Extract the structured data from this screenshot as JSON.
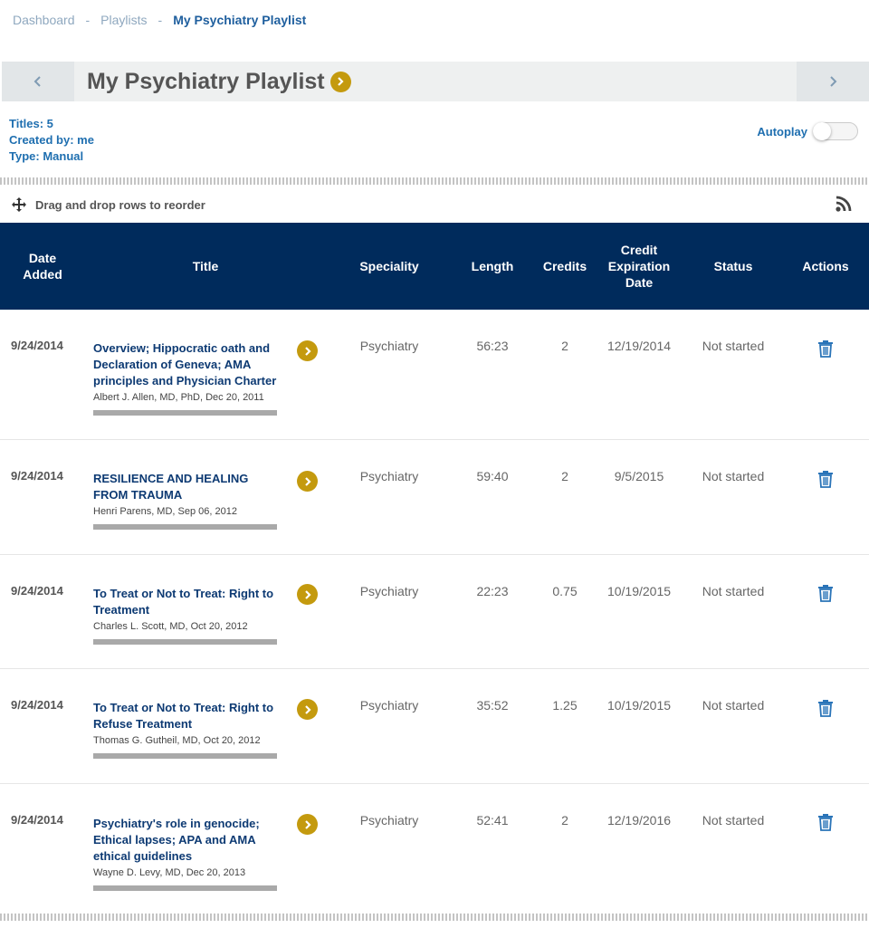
{
  "breadcrumb": {
    "items": [
      "Dashboard",
      "Playlists"
    ],
    "separator": "-",
    "current": "My Psychiatry Playlist"
  },
  "header": {
    "title": "My Psychiatry Playlist",
    "prev_icon": "chevron-left-icon",
    "next_icon": "chevron-right-icon"
  },
  "meta": {
    "titles": "Titles: 5",
    "created_by": "Created by: me",
    "type": "Type: Manual"
  },
  "autoplay": {
    "label": "Autoplay",
    "on": false
  },
  "reorder_hint": "Drag and drop rows to reorder",
  "columns": {
    "date_added": "Date Added",
    "title": "Title",
    "speciality": "Speciality",
    "length": "Length",
    "credits": "Credits",
    "credit_expiration": "Credit Expiration Date",
    "status": "Status",
    "actions": "Actions"
  },
  "rows": [
    {
      "date": "9/24/2014",
      "title": "Overview; Hippocratic oath and Declaration of Geneva; AMA principles and Physician Charter",
      "author": "Albert J. Allen, MD, PhD, Dec 20, 2011",
      "speciality": "Psychiatry",
      "length": "56:23",
      "credits": "2",
      "expiration": "12/19/2014",
      "status": "Not started"
    },
    {
      "date": "9/24/2014",
      "title": "RESILIENCE AND HEALING FROM TRAUMA",
      "author": "Henri Parens, MD, Sep 06, 2012",
      "speciality": "Psychiatry",
      "length": "59:40",
      "credits": "2",
      "expiration": "9/5/2015",
      "status": "Not started"
    },
    {
      "date": "9/24/2014",
      "title": "To Treat or Not to Treat: Right to Treatment",
      "author": "Charles L. Scott, MD, Oct 20, 2012",
      "speciality": "Psychiatry",
      "length": "22:23",
      "credits": "0.75",
      "expiration": "10/19/2015",
      "status": "Not started"
    },
    {
      "date": "9/24/2014",
      "title": "To Treat or Not to Treat: Right to Refuse Treatment",
      "author": "Thomas G. Gutheil, MD, Oct 20, 2012",
      "speciality": "Psychiatry",
      "length": "35:52",
      "credits": "1.25",
      "expiration": "10/19/2015",
      "status": "Not started"
    },
    {
      "date": "9/24/2014",
      "title": "Psychiatry's role in genocide; Ethical lapses; APA and AMA ethical guidelines",
      "author": "Wayne D. Levy, MD, Dec 20, 2013",
      "speciality": "Psychiatry",
      "length": "52:41",
      "credits": "2",
      "expiration": "12/19/2016",
      "status": "Not started"
    }
  ],
  "colors": {
    "header_bg": "#002b5c",
    "link": "#1f6fb0",
    "title_link": "#0d3a73",
    "gold": "#c49a0e"
  }
}
